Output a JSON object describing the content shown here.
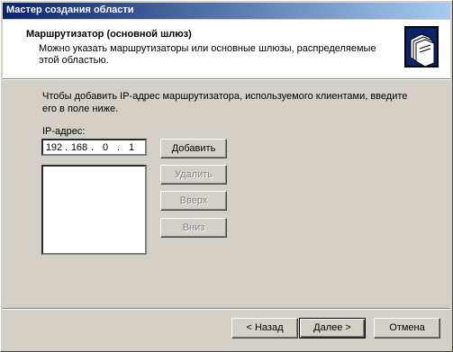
{
  "window": {
    "title": "Мастер создания области"
  },
  "header": {
    "title": "Маршрутизатор (основной шлюз)",
    "subtitle": "Можно указать маршрутизаторы или основные шлюзы, распределяемые этой областью.",
    "icon": "wizard-folders-icon"
  },
  "body": {
    "instruction": "Чтобы добавить IP-адрес маршрутизатора, используемого клиентами, введите его в поле ниже.",
    "ip_label": "IP-адрес:",
    "ip_octets": [
      "192",
      "168",
      "0",
      "1"
    ],
    "ip_list": []
  },
  "buttons": {
    "add": "Добавить",
    "remove": "Удалить",
    "up": "Вверх",
    "down": "Вниз"
  },
  "footer": {
    "back": "< Назад",
    "next": "Далее >",
    "cancel": "Отмена"
  }
}
